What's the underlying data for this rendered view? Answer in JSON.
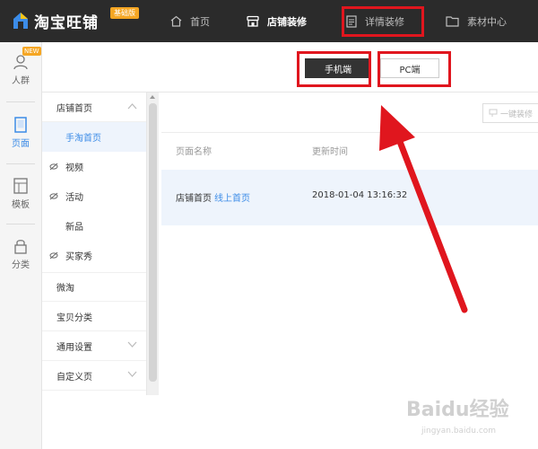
{
  "brand": {
    "name": "淘宝旺铺",
    "badge": "基础版"
  },
  "topnav": {
    "items": [
      {
        "label": "首页",
        "icon": "home-icon"
      },
      {
        "label": "店铺装修",
        "icon": "store-icon",
        "active": true
      },
      {
        "label": "详情装修",
        "icon": "document-icon",
        "highlighted": true
      },
      {
        "label": "素材中心",
        "icon": "folder-icon"
      }
    ]
  },
  "rail": {
    "items": [
      {
        "label": "人群",
        "icon": "person-icon",
        "badge": "NEW"
      },
      {
        "label": "页面",
        "icon": "page-icon",
        "active": true
      },
      {
        "label": "模板",
        "icon": "template-icon"
      },
      {
        "label": "分类",
        "icon": "lock-icon"
      }
    ]
  },
  "device_tabs": {
    "mobile": "手机端",
    "pc": "PC端"
  },
  "subnav": {
    "items": [
      {
        "label": "店铺首页",
        "type": "group",
        "expanded": true
      },
      {
        "label": "手淘首页",
        "type": "child",
        "active": true
      },
      {
        "label": "视频",
        "type": "child",
        "hidden_icon": true
      },
      {
        "label": "活动",
        "type": "child",
        "hidden_icon": true
      },
      {
        "label": "新品",
        "type": "child"
      },
      {
        "label": "买家秀",
        "type": "child",
        "hidden_icon": true
      },
      {
        "label": "微淘",
        "type": "group"
      },
      {
        "label": "宝贝分类",
        "type": "group"
      },
      {
        "label": "通用设置",
        "type": "group",
        "expandable": true
      },
      {
        "label": "自定义页",
        "type": "group",
        "expandable": true
      }
    ]
  },
  "main": {
    "onekey_button": "一键装修",
    "columns": [
      "页面名称",
      "更新时间"
    ],
    "rows": [
      {
        "name": "店铺首页",
        "status_link": "线上首页",
        "updated": "2018-01-04 13:16:32"
      }
    ]
  },
  "watermark": {
    "text": "Baidu经验",
    "sub": "jingyan.baidu.com"
  },
  "colors": {
    "topbar": "#2b2b2b",
    "accent": "#3c8ce7",
    "highlight": "#e0161e",
    "badge": "#f5a623"
  }
}
